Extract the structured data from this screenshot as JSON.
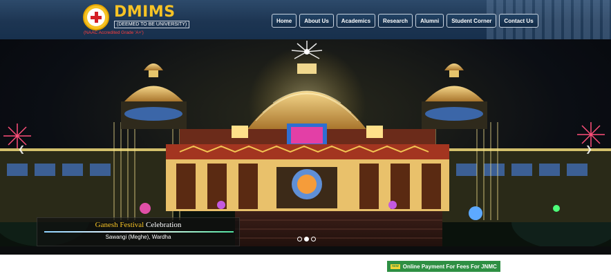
{
  "header": {
    "brand": "DMIMS",
    "deemed": "(DEEMED TO BE UNIVERSITY)",
    "accreditation": "(NAAC Accredited Grade 'A+')"
  },
  "nav": {
    "items": [
      "Home",
      "About Us",
      "Academics",
      "Research",
      "Alumni",
      "Student Corner",
      "Contact Us"
    ]
  },
  "slider": {
    "caption_highlight": "Ganesh Festival",
    "caption_rest": " Celebration",
    "caption_sub": "Sawangi (Meghe), Wardha",
    "prev_icon": "chevron-left-icon",
    "next_icon": "chevron-right-icon",
    "slides": 3,
    "active_slide": 2
  },
  "notice": {
    "badge": "new",
    "text": "Online Payment For Fees For JNMC"
  },
  "colors": {
    "header_bg": "#1d3552",
    "brand_yellow": "#f7c325",
    "notice_green": "#2e8f43"
  }
}
